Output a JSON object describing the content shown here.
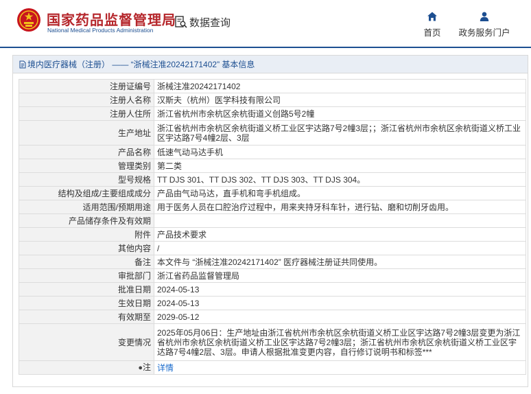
{
  "header": {
    "brand_cn": "国家药品监督管理局",
    "brand_en": "National Medical Products Administration",
    "query_label": "数据查询",
    "nav": [
      {
        "label": "首页",
        "icon": "home-icon"
      },
      {
        "label": "政务服务门户",
        "icon": "user-icon"
      }
    ]
  },
  "panel": {
    "title": "境内医疗器械（注册） —— “浙械注准20242171402” 基本信息"
  },
  "rows": [
    {
      "key": "注册证编号",
      "value": "浙械注准20242171402"
    },
    {
      "key": "注册人名称",
      "value": "汉斯夫（杭州）医学科技有限公司"
    },
    {
      "key": "注册人住所",
      "value": "浙江省杭州市余杭区余杭街道义创路5号2幢"
    },
    {
      "key": "生产地址",
      "value": "浙江省杭州市余杭区余杭街道义桥工业区宇达路7号2幢3层；；浙江省杭州市余杭区余杭街道义桥工业区宇达路7号4幢2层、3层"
    },
    {
      "key": "产品名称",
      "value": "低速气动马达手机"
    },
    {
      "key": "管理类别",
      "value": "第二类"
    },
    {
      "key": "型号规格",
      "value": "TT DJS 301、TT DJS 302、TT DJS 303、TT DJS 304。"
    },
    {
      "key": "结构及组成/主要组成成分",
      "value": "产品由气动马达，直手机和弯手机组成。"
    },
    {
      "key": "适用范围/预期用途",
      "value": "用于医务人员在口腔治疗过程中，用来夹持牙科车针，进行钻、磨和切削牙齿用。"
    },
    {
      "key": "产品储存条件及有效期",
      "value": ""
    },
    {
      "key": "附件",
      "value": "产品技术要求"
    },
    {
      "key": "其他内容",
      "value": "/"
    },
    {
      "key": "备注",
      "value": "本文件与 “浙械注准20242171402” 医疗器械注册证共同使用。"
    },
    {
      "key": "审批部门",
      "value": "浙江省药品监督管理局"
    },
    {
      "key": "批准日期",
      "value": "2024-05-13"
    },
    {
      "key": "生效日期",
      "value": "2024-05-13"
    },
    {
      "key": "有效期至",
      "value": "2029-05-12"
    },
    {
      "key": "变更情况",
      "value": "2025年05月06日：生产地址由浙江省杭州市余杭区余杭街道义桥工业区宇达路7号2幢3层变更为浙江省杭州市余杭区余杭街道义桥工业区宇达路7号2幢3层；浙江省杭州市余杭区余杭街道义桥工业区宇达路7号4幢2层、3层。申请人根据批准变更内容，自行修订说明书和标签***"
    },
    {
      "key": "注",
      "value": "详情"
    }
  ],
  "icons": {
    "logo": "emblem-logo",
    "query": "data-search-icon",
    "title": "document-icon",
    "note": "pin-icon"
  },
  "colors": {
    "brand_red": "#b5262b",
    "brand_blue": "#1d4f91",
    "link": "#1a6bcc"
  }
}
